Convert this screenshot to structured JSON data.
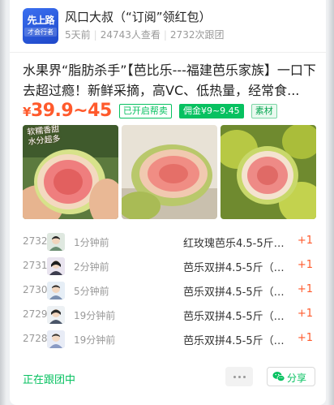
{
  "author": {
    "avatar_text_line1": "先上路",
    "avatar_text_line2": "才会行者",
    "name": "风口大叔（“订阅”领红包）",
    "time": "5天前",
    "views": "24743人查看",
    "follows": "2732次跟团"
  },
  "post": {
    "title": "水果界“脂肪杀手”【芭比乐---福建芭乐家族】一口下去超过瘾！新鲜采摘，高VC、低热量，经常食...",
    "price_currency": "¥",
    "price_range": "39.9~45",
    "tags": [
      "已开启帮卖",
      "佣金¥9~9.45",
      "素材"
    ],
    "photo1_caption": "软糯香甜\n水分超多"
  },
  "followers": [
    {
      "num": "2732",
      "time": "1分钟前",
      "item": "红玫瑰芭乐4.5-5斤…",
      "count": "+1"
    },
    {
      "num": "2731",
      "time": "2分钟前",
      "item": "芭乐双拼4.5-5斤（…",
      "count": "+1"
    },
    {
      "num": "2730",
      "time": "5分钟前",
      "item": "芭乐双拼4.5-5斤（…",
      "count": "+1"
    },
    {
      "num": "2729",
      "time": "19分钟前",
      "item": "芭乐双拼4.5-5斤（…",
      "count": "+1"
    },
    {
      "num": "2728",
      "time": "19分钟前",
      "item": "芭乐双拼4.5-5斤（…",
      "count": "+1"
    }
  ],
  "footer": {
    "status": "正在跟团中",
    "share_label": "分享",
    "more_icon": "ellipsis-icon",
    "share_icon": "wechat-icon"
  },
  "colors": {
    "accent_green": "#07c160",
    "price_orange": "#ff5a2c",
    "avatar_blue": "#2f5fe0"
  }
}
